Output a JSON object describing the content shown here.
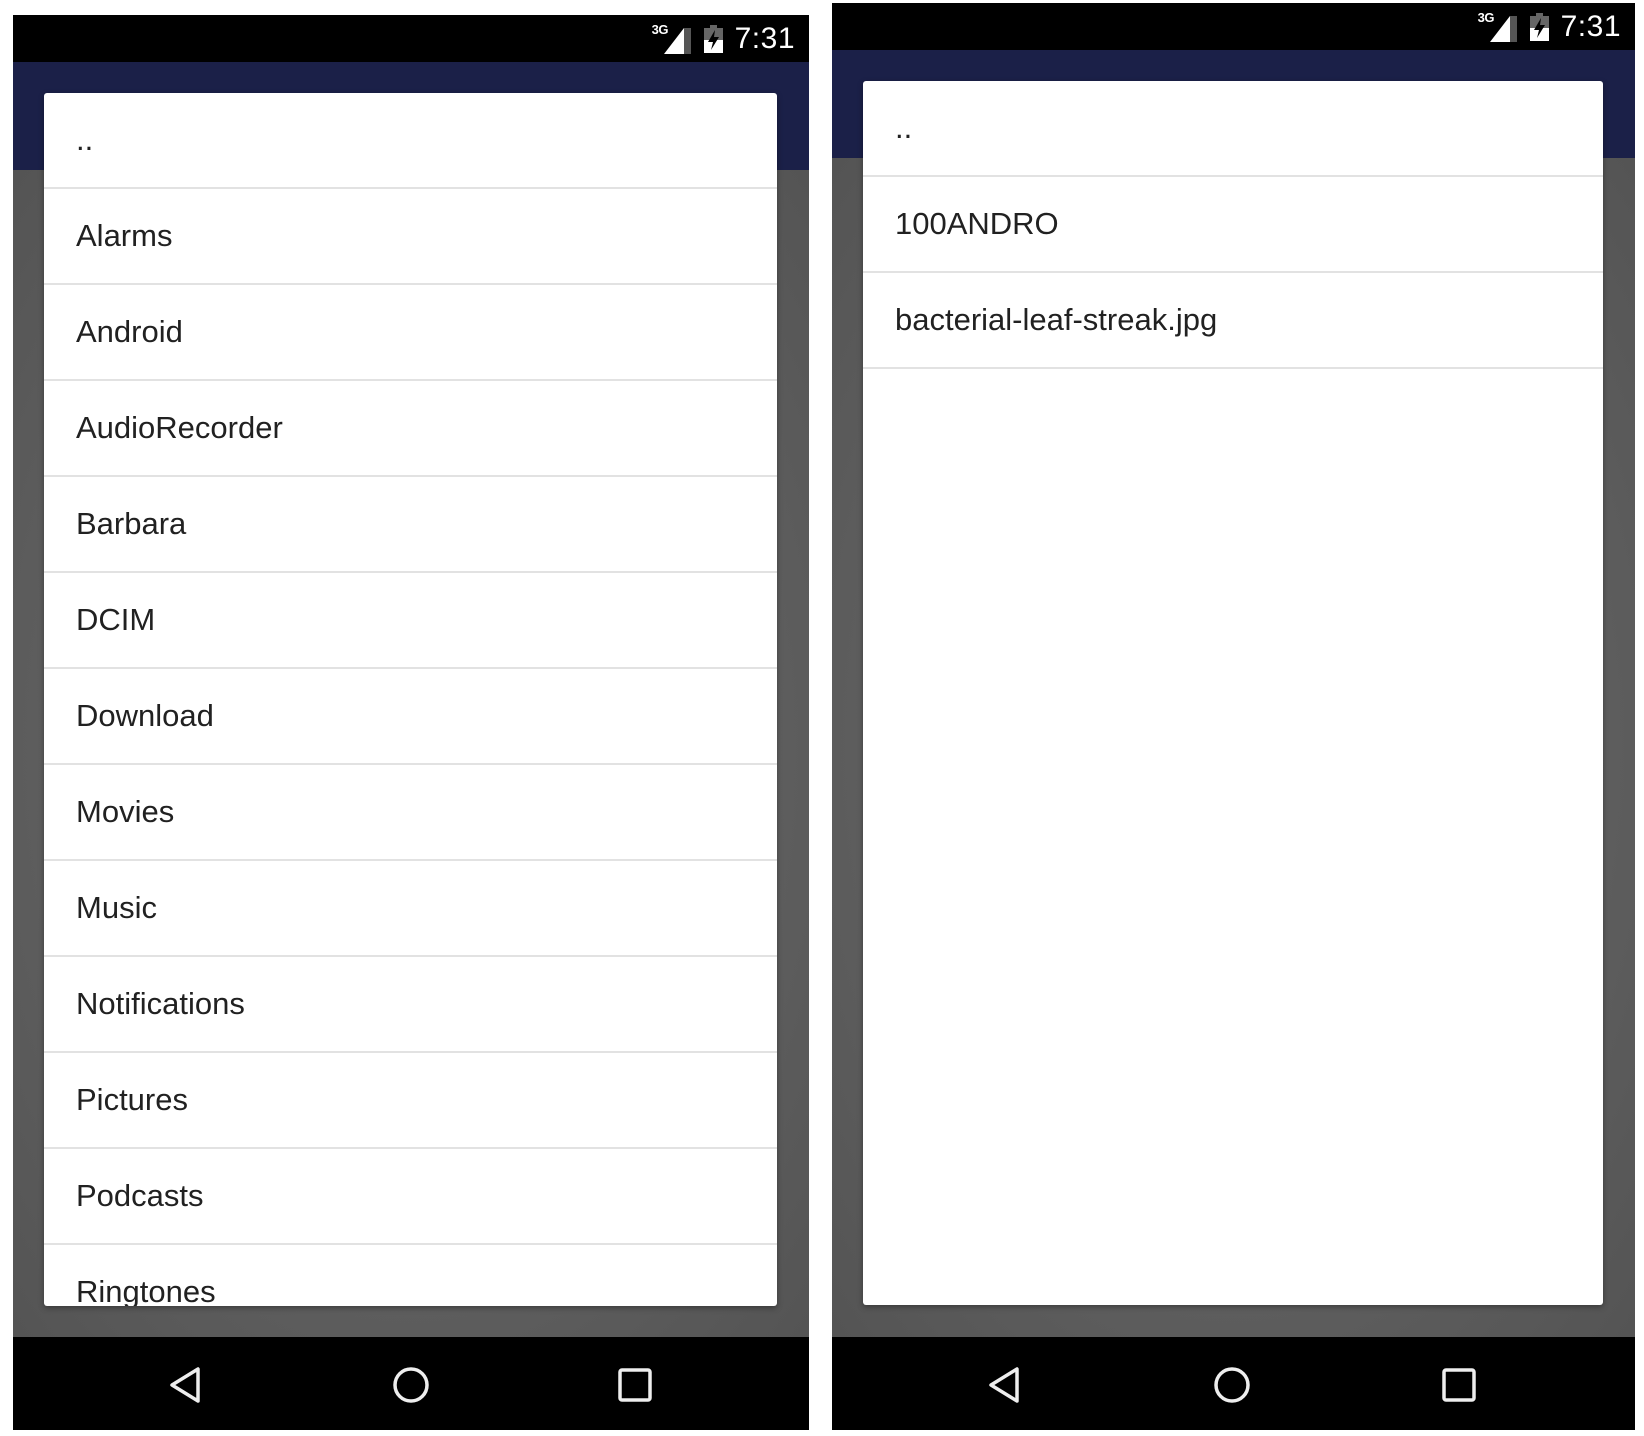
{
  "screens": [
    {
      "status": {
        "network": "3G",
        "time": "7:31"
      },
      "list": [
        "..",
        "Alarms",
        "Android",
        "AudioRecorder",
        "Barbara",
        "DCIM",
        "Download",
        "Movies",
        "Music",
        "Notifications",
        "Pictures",
        "Podcasts",
        "Ringtones"
      ]
    },
    {
      "status": {
        "network": "3G",
        "time": "7:31"
      },
      "list": [
        "..",
        "100ANDRO",
        "bacterial-leaf-streak.jpg"
      ]
    }
  ],
  "navbar": {
    "icons": [
      "back-icon",
      "home-icon",
      "recents-icon"
    ]
  },
  "colors": {
    "appbar": "#1b2048",
    "statusbar": "#000000",
    "scrim": "#5c5c5c",
    "text": "#212121",
    "divider": "#e2e2e2"
  }
}
